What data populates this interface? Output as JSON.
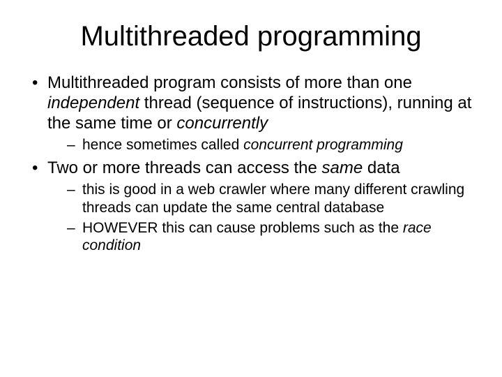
{
  "title": "Multithreaded programming",
  "b1": {
    "pre": "Multithreaded program consists of more than one ",
    "italic1": "independent",
    "mid": " thread (sequence of instructions), running at the same time or ",
    "italic2": "concurrently",
    "sub1": {
      "pre": "hence sometimes called ",
      "italic": "concurrent programming"
    }
  },
  "b2": {
    "pre": "Two or more threads can access the ",
    "italic": "same",
    "post": " data",
    "sub1": "this is good in a web crawler where many different crawling threads can update the same central database",
    "sub2": {
      "pre": "HOWEVER this can cause problems such as the ",
      "italic": "race condition"
    }
  }
}
